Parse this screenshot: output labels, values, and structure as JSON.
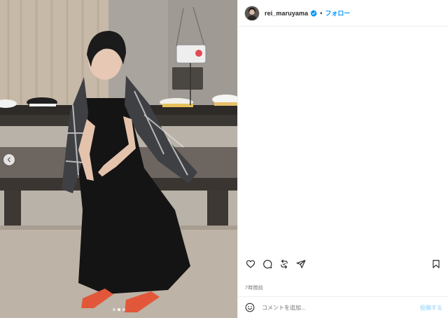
{
  "header": {
    "username": "rei_maruyama",
    "separator": "•",
    "follow_label": "フォロー"
  },
  "media": {
    "carousel_dots": 3,
    "active_dot": 2
  },
  "actions": {
    "icons": [
      "heart-icon",
      "comment-icon",
      "repost-icon",
      "share-icon",
      "bookmark-icon"
    ]
  },
  "meta": {
    "time_ago": "7時間前"
  },
  "composer": {
    "placeholder": "コメントを追加...",
    "post_label": "投稿する"
  },
  "colors": {
    "follow_blue": "#0095f6",
    "post_disabled": "#b2dffc",
    "verified_blue": "#0095f6",
    "muted_text": "#737373"
  }
}
